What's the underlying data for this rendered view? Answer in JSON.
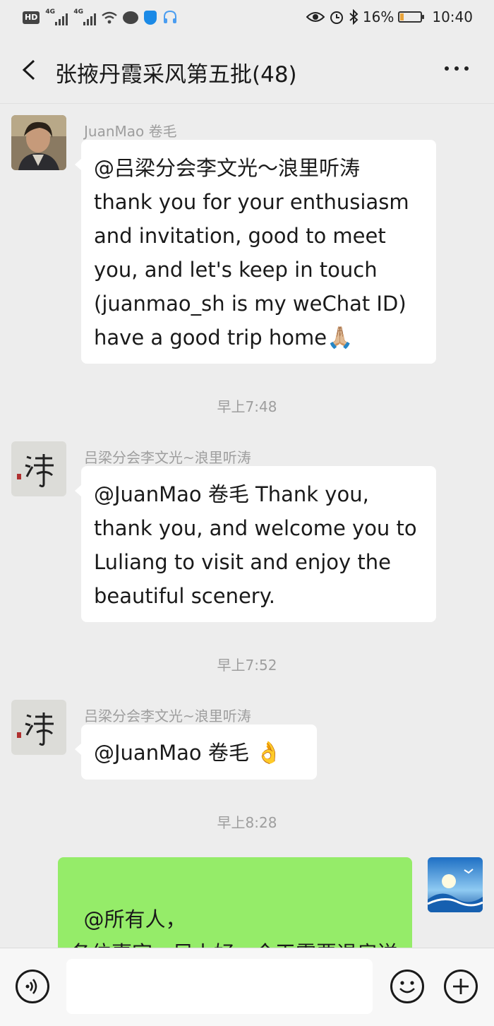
{
  "status_bar": {
    "network_1": "4G",
    "network_2": "4G",
    "battery_percent": "16%",
    "battery_level": 0.16,
    "time": "10:40",
    "icons": [
      "hd-icon",
      "signal-icon",
      "signal-icon",
      "wifi-icon",
      "message-icon",
      "shield-icon",
      "headset-icon",
      "eye-icon",
      "alarm-icon",
      "bluetooth-icon",
      "battery-icon"
    ]
  },
  "header": {
    "title": "张掖丹霞采风第五批(48)",
    "back_icon": "chevron-left-icon",
    "more_icon": "more-icon"
  },
  "messages": [
    {
      "sender": "JuanMao 卷毛",
      "text": "@吕梁分会李文光～浪里听涛  thank you for your enthusiasm and invitation, good to meet you, and let's keep in touch (juanmao_sh is my weChat ID) have a good trip home",
      "emoji": "🙏🏼"
    },
    {
      "timestamp": "早上7:48"
    },
    {
      "sender": "吕梁分会李文光~浪里听涛",
      "text": "@JuanMao 卷毛  Thank you, thank you, and welcome you to Luliang to visit and enjoy the beautiful scenery."
    },
    {
      "timestamp": "早上7:52"
    },
    {
      "sender": "吕梁分会李文光~浪里听涛",
      "text": "@JuanMao 卷毛 ",
      "emoji": "👌"
    },
    {
      "timestamp": "早上8:28"
    },
    {
      "self": true,
      "text": "@所有人，\n各位嘉宾，早上好，今天需要退房送出车站和高铁西站的请集近"
    }
  ],
  "bottom_bar": {
    "voice_icon": "voice-icon",
    "input_value": "",
    "emoji_icon": "emoji-icon",
    "plus_icon": "plus-icon"
  }
}
